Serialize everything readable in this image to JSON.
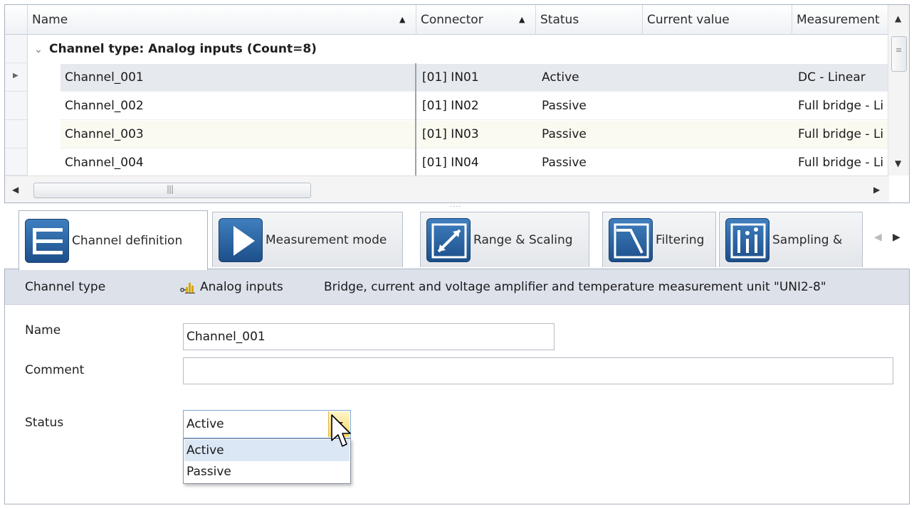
{
  "grid": {
    "columns": {
      "name": "Name",
      "connector": "Connector",
      "status": "Status",
      "current_value": "Current value",
      "measurement": "Measurement"
    },
    "group_label": "Channel type: Analog inputs (Count=8)",
    "rows": [
      {
        "name": "Channel_001",
        "connector": "[01] IN01",
        "status": "Active",
        "current_value": "",
        "measurement": "DC - Linear"
      },
      {
        "name": "Channel_002",
        "connector": "[01] IN02",
        "status": "Passive",
        "current_value": "",
        "measurement": "Full bridge - Li"
      },
      {
        "name": "Channel_003",
        "connector": "[01] IN03",
        "status": "Passive",
        "current_value": "",
        "measurement": "Full bridge - Li"
      },
      {
        "name": "Channel_004",
        "connector": "[01] IN04",
        "status": "Passive",
        "current_value": "",
        "measurement": "Full bridge - Li"
      }
    ]
  },
  "tabs": [
    {
      "label": "Channel definition",
      "icon": "channel-definition-icon"
    },
    {
      "label": "Measurement mode",
      "icon": "play-icon"
    },
    {
      "label": "Range & Scaling",
      "icon": "range-scaling-icon"
    },
    {
      "label": "Filtering",
      "icon": "filter-icon"
    },
    {
      "label": "Sampling &",
      "icon": "sampling-icon"
    }
  ],
  "channel_type": {
    "label": "Channel type",
    "value": "Analog inputs",
    "description": "Bridge, current and voltage amplifier and temperature measurement unit \"UNI2-8\""
  },
  "form": {
    "name_label": "Name",
    "name_value": "Channel_001",
    "comment_label": "Comment",
    "comment_value": "",
    "status_label": "Status",
    "status_value": "Active",
    "status_options": [
      "Active",
      "Passive"
    ]
  },
  "colors": {
    "accent_blue": "#1d4f8a",
    "selection_row": "#e6e9ee",
    "highlight_option": "#dbe7f5",
    "combo_button": "#f7d565"
  }
}
